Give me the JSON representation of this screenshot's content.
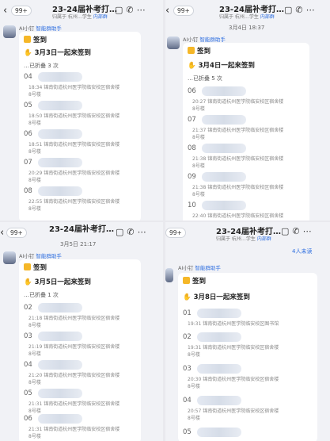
{
  "panels": [
    {
      "id": "q1",
      "header": {
        "back_count": "99+",
        "title": "23-24届补考打…",
        "subtitle_text": "归属于 杭州…学生",
        "subtitle_tag": "内部群",
        "icons": [
          "bag-icon",
          "call-icon",
          "more-icon"
        ]
      },
      "date_label": "",
      "sender": {
        "name": "AI小钉",
        "tag": "智能群助手"
      },
      "card": {
        "title": "签到",
        "theme": "3月3日一起来签到",
        "folded": "…已折叠 3 次"
      },
      "entries": [
        {
          "num": "04",
          "time": "18:34",
          "loc1": "锦南街道杭州医学院临安校区宿舍楼",
          "loc2": "8号楼"
        },
        {
          "num": "05",
          "time": "18:50",
          "loc1": "锦南街道杭州医学院临安校区宿舍楼",
          "loc2": "8号楼"
        },
        {
          "num": "06",
          "time": "18:51",
          "loc1": "锦南街道杭州医学院临安校区宿舍楼",
          "loc2": "8号楼"
        },
        {
          "num": "07",
          "time": "20:29",
          "loc1": "锦南街道杭州医学院临安校区宿舍楼",
          "loc2": "8号楼"
        },
        {
          "num": "08",
          "time": "22:55",
          "loc1": "锦南街道杭州医学院临安校区宿舍楼",
          "loc2": "8号楼"
        }
      ]
    },
    {
      "id": "q2",
      "header": {
        "back_count": "99+",
        "title": "23-24届补考打…",
        "subtitle_text": "归属于 杭州…学生",
        "subtitle_tag": "内部群",
        "icons": [
          "bag-icon",
          "call-icon",
          "more-icon"
        ]
      },
      "date_label": "3月4日 18:37",
      "sender": {
        "name": "AI小钉",
        "tag": "智能群助手"
      },
      "card": {
        "title": "签到",
        "theme": "3月4日一起来签到",
        "folded": "…已折叠 5 次"
      },
      "entries": [
        {
          "num": "06",
          "time": "20:27",
          "loc1": "锦南街道杭州医学院临安校区宿舍楼",
          "loc2": "8号楼"
        },
        {
          "num": "07",
          "time": "21:37",
          "loc1": "锦南街道杭州医学院临安校区宿舍楼",
          "loc2": "8号楼"
        },
        {
          "num": "08",
          "time": "21:38",
          "loc1": "锦南街道杭州医学院临安校区宿舍楼",
          "loc2": "8号楼"
        },
        {
          "num": "09",
          "time": "21:38",
          "loc1": "锦南街道杭州医学院临安校区宿舍楼",
          "loc2": "8号楼"
        },
        {
          "num": "10",
          "time": "22:40",
          "loc1": "锦南街道杭州医学院临安校区宿舍楼",
          "loc2": ""
        }
      ]
    },
    {
      "id": "q3",
      "header": {
        "back_count": "99+",
        "title": "23-24届补考打…",
        "subtitle_text": "",
        "subtitle_tag": "",
        "icons": [
          "bag-icon",
          "call-icon",
          "more-icon"
        ]
      },
      "date_label": "3月5日 21:17",
      "sender": {
        "name": "AI小钉",
        "tag": "智能群助手"
      },
      "card": {
        "title": "签到",
        "theme": "3月5日一起来签到",
        "folded": "…已折叠 1 次"
      },
      "entries": [
        {
          "num": "02",
          "time": "21:18",
          "loc1": "锦南街道杭州医学院临安校区宿舍楼",
          "loc2": "8号楼"
        },
        {
          "num": "03",
          "time": "21:19",
          "loc1": "锦南街道杭州医学院临安校区宿舍楼",
          "loc2": "8号楼"
        },
        {
          "num": "04",
          "time": "21:20",
          "loc1": "锦南街道杭州医学院临安校区宿舍楼",
          "loc2": "8号楼"
        },
        {
          "num": "05",
          "time": "21:31",
          "loc1": "锦南街道杭州医学院临安校区宿舍楼",
          "loc2": "8号楼"
        },
        {
          "num": "06",
          "time": "21:31",
          "loc1": "锦南街道杭州医学院临安校区宿舍楼",
          "loc2": "8号楼"
        }
      ]
    },
    {
      "id": "q4",
      "header": {
        "back_count": "99+",
        "title": "23-24届补考打…",
        "subtitle_text": "归属于 杭州…学生",
        "subtitle_tag": "内部群",
        "icons": [
          "bag-icon",
          "call-icon",
          "more-icon"
        ]
      },
      "date_label": "",
      "unread": "4人未读",
      "sender": {
        "name": "AI小钉",
        "tag": "智能群助手"
      },
      "card": {
        "title": "签到",
        "theme": "3月8日一起来签到",
        "folded": ""
      },
      "entries": [
        {
          "num": "01",
          "time": "19:31",
          "loc1": "锦南街道杭州医学院临安校区图书馆",
          "loc2": ""
        },
        {
          "num": "02",
          "time": "19:31",
          "loc1": "锦南街道杭州医学院临安校区宿舍楼",
          "loc2": "8号楼"
        },
        {
          "num": "03",
          "time": "20:30",
          "loc1": "锦南街道杭州医学院临安校区宿舍楼",
          "loc2": "8号楼"
        },
        {
          "num": "04",
          "time": "20:57",
          "loc1": "锦南街道杭州医学院临安校区宿舍楼",
          "loc2": "8号楼"
        },
        {
          "num": "05",
          "time": "",
          "loc1": "",
          "loc2": ""
        }
      ]
    }
  ]
}
